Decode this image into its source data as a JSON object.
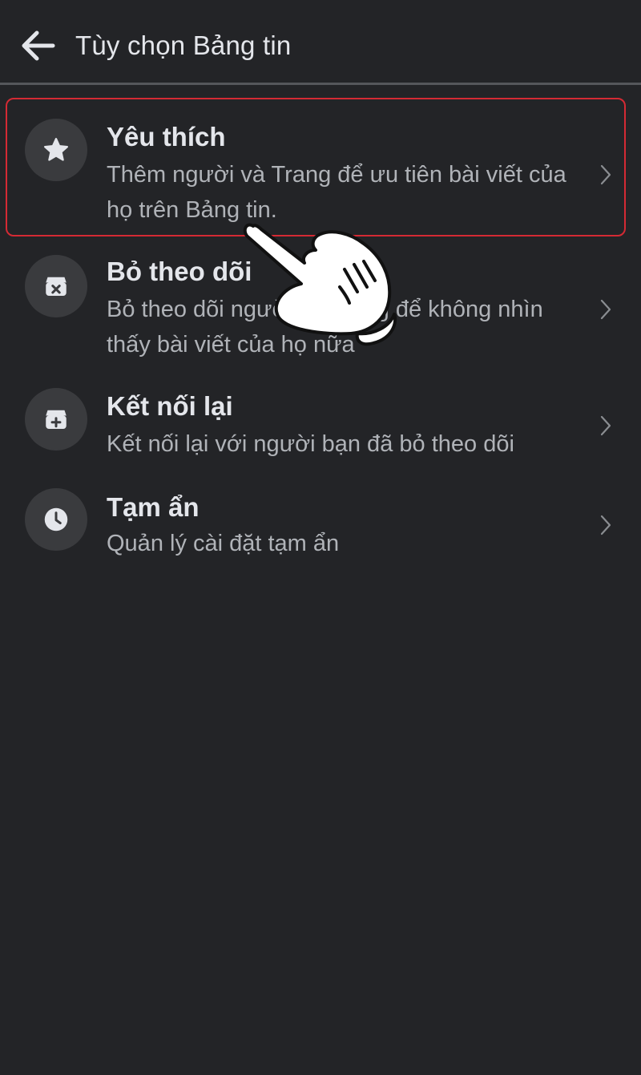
{
  "header": {
    "title": "Tùy chọn Bảng tin"
  },
  "menu": {
    "items": [
      {
        "title": "Yêu thích",
        "description": "Thêm người và Trang để ưu tiên bài viết của họ trên Bảng tin.",
        "icon": "star-icon"
      },
      {
        "title": "Bỏ theo dõi",
        "description": "Bỏ theo dõi người và Trang để không nhìn thấy bài viết của họ nữa",
        "icon": "unfollow-icon"
      },
      {
        "title": "Kết nối lại",
        "description": "Kết nối lại với người bạn đã bỏ theo dõi",
        "icon": "reconnect-icon"
      },
      {
        "title": "Tạm ẩn",
        "description": "Quản lý cài đặt tạm ẩn",
        "icon": "clock-icon"
      }
    ]
  },
  "colors": {
    "background": "#232427",
    "icon_circle": "#3a3b3e",
    "title_text": "#e4e6eb",
    "secondary_text": "#b0b3b8",
    "highlight_border": "#d42a34"
  }
}
